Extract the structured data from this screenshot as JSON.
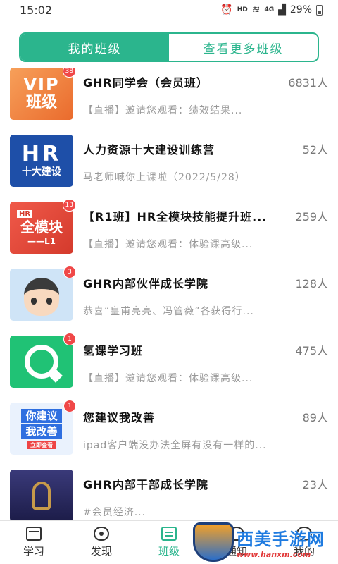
{
  "status": {
    "time": "15:02",
    "hd": "HD",
    "network": "4G",
    "battery": "29%"
  },
  "tabs": {
    "mine": "我的班级",
    "more": "查看更多班级"
  },
  "classes": [
    {
      "title": "GHR同学会（会员班）",
      "count": "6831人",
      "message": "【直播】邀请您观看：绩效结果...",
      "badge": "38",
      "thumb": [
        "VIP",
        "班级"
      ]
    },
    {
      "title": "人力资源十大建设训练营",
      "count": "52人",
      "message": "马老师喊你上课啦（2022/5/28）",
      "badge": "",
      "thumb": [
        "HR",
        "十大建设"
      ]
    },
    {
      "title": "【R1班】HR全模块技能提升班...",
      "count": "259人",
      "message": "【直播】邀请您观看：体验课高级...",
      "badge": "13",
      "thumb": [
        "HR",
        "全模块",
        "——L1"
      ]
    },
    {
      "title": "GHR内部伙伴成长学院",
      "count": "128人",
      "message": "恭喜“皇甫亮亮、冯管薇”各获得行...",
      "badge": "3",
      "thumb": []
    },
    {
      "title": "氢课学习班",
      "count": "475人",
      "message": "【直播】邀请您观看：体验课高级...",
      "badge": "1",
      "thumb": []
    },
    {
      "title": "您建议我改善",
      "count": "89人",
      "message": "ipad客户端没办法全屏有没有一样的...",
      "badge": "1",
      "thumb": [
        "你建议",
        "我改善",
        "立即查看"
      ]
    },
    {
      "title": "GHR内部干部成长学院",
      "count": "23人",
      "message": "#会员经济...",
      "badge": "",
      "thumb": []
    }
  ],
  "tabbar": {
    "learn": "学习",
    "discover": "发现",
    "cls": "班级",
    "notify": "通知",
    "mine": "我的"
  },
  "watermark": {
    "main": "西美手游网",
    "url": "www.hanxm.com"
  },
  "colors": {
    "accent": "#2bb58d",
    "badge": "#f04848"
  }
}
